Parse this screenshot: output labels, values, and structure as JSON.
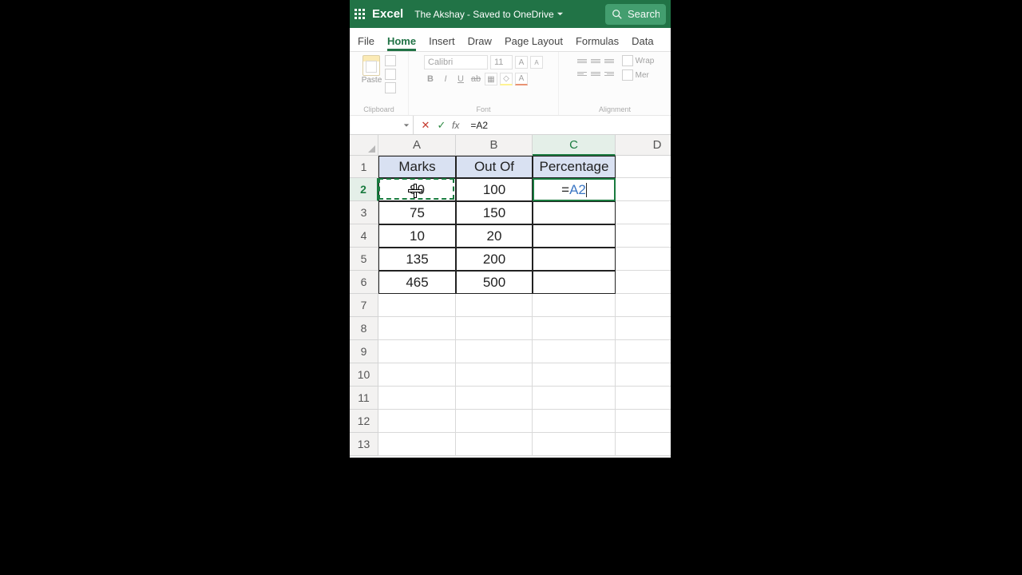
{
  "titlebar": {
    "brand": "Excel",
    "doc_title": "The Akshay",
    "save_status": " - Saved to OneDrive",
    "search_placeholder": "Search"
  },
  "tabs": {
    "items": [
      "File",
      "Home",
      "Insert",
      "Draw",
      "Page Layout",
      "Formulas",
      "Data"
    ],
    "active": "Home"
  },
  "ribbon": {
    "clipboard": {
      "paste": "Paste",
      "label": "Clipboard"
    },
    "font": {
      "family": "Calibri",
      "size": "11",
      "label": "Font"
    },
    "alignment": {
      "wrap": "Wrap",
      "merge": "Mer",
      "label": "Alignment"
    }
  },
  "formula_bar": {
    "namebox": "",
    "formula": "=A2"
  },
  "columns": [
    "A",
    "B",
    "C",
    "D"
  ],
  "active_col": "C",
  "active_row": "2",
  "rows": [
    "1",
    "2",
    "3",
    "4",
    "5",
    "6",
    "7",
    "8",
    "9",
    "10",
    "11",
    "12",
    "13"
  ],
  "headers": {
    "A": "Marks",
    "B": "Out Of",
    "C": "Percentage"
  },
  "active_cell_formula": {
    "eq": "=",
    "ref": "A2"
  },
  "chart_data": {
    "type": "table",
    "columns": [
      "Marks",
      "Out Of",
      "Percentage"
    ],
    "rows": [
      {
        "Marks": 80,
        "Out Of": 100,
        "Percentage": "=A2"
      },
      {
        "Marks": 75,
        "Out Of": 150,
        "Percentage": ""
      },
      {
        "Marks": 10,
        "Out Of": 20,
        "Percentage": ""
      },
      {
        "Marks": 135,
        "Out Of": 200,
        "Percentage": ""
      },
      {
        "Marks": 465,
        "Out Of": 500,
        "Percentage": ""
      }
    ]
  },
  "colors": {
    "excel_green": "#217346",
    "header_fill": "#d9e1f2",
    "ref_blue": "#3c77c4"
  }
}
